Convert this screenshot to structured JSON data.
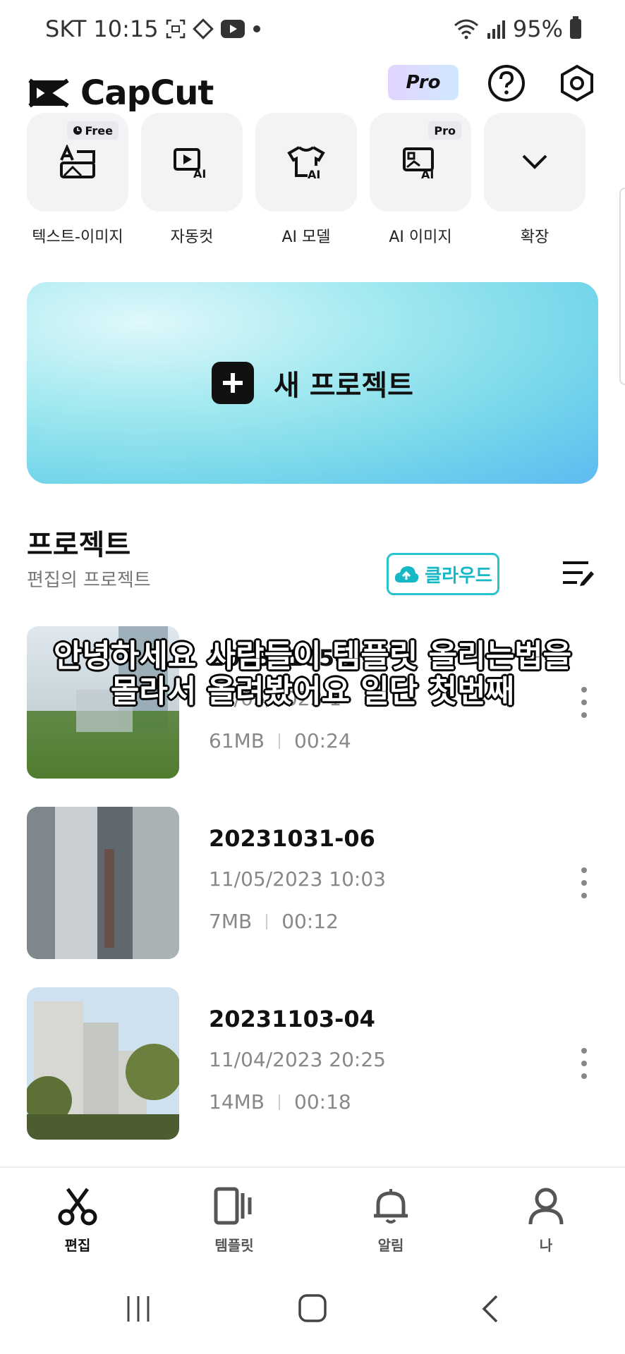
{
  "status_bar": {
    "carrier": "SKT",
    "time": "10:15",
    "battery": "95%"
  },
  "header": {
    "app_name": "CapCut",
    "pro_label": "Pro"
  },
  "tools": [
    {
      "label": "텍스트-이미지",
      "badge": "Free",
      "icon": "text-to-image-icon"
    },
    {
      "label": "자동컷",
      "badge": "",
      "icon": "autocut-icon"
    },
    {
      "label": "AI 모델",
      "badge": "",
      "icon": "ai-model-icon"
    },
    {
      "label": "AI 이미지",
      "badge": "Pro",
      "icon": "ai-image-icon"
    },
    {
      "label": "확장",
      "badge": "",
      "icon": "chevron-down-icon"
    }
  ],
  "new_project": {
    "label": "새 프로젝트"
  },
  "projects_section": {
    "title": "프로젝트",
    "subtitle": "편집의 프로젝트",
    "cloud_label": "클라우드"
  },
  "projects": [
    {
      "name": "20231105-0",
      "date": "11/05/2023 1",
      "size": "61MB",
      "duration": "00:24"
    },
    {
      "name": "20231031-06",
      "date": "11/05/2023 10:03",
      "size": "7MB",
      "duration": "00:12"
    },
    {
      "name": "20231103-04",
      "date": "11/04/2023 20:25",
      "size": "14MB",
      "duration": "00:18"
    }
  ],
  "caption": {
    "line1": "안녕하세요 사람들이 템플릿 올리는법을",
    "line2": "몰라서 올려봤어요 일단 첫번째"
  },
  "bottom_nav": [
    {
      "label": "편집",
      "active": true
    },
    {
      "label": "템플릿",
      "active": false
    },
    {
      "label": "알림",
      "active": false
    },
    {
      "label": "나",
      "active": false
    }
  ],
  "colors": {
    "accent": "#27c3cf",
    "banner_start": "#dff8fb",
    "banner_end": "#5dbaf2"
  }
}
